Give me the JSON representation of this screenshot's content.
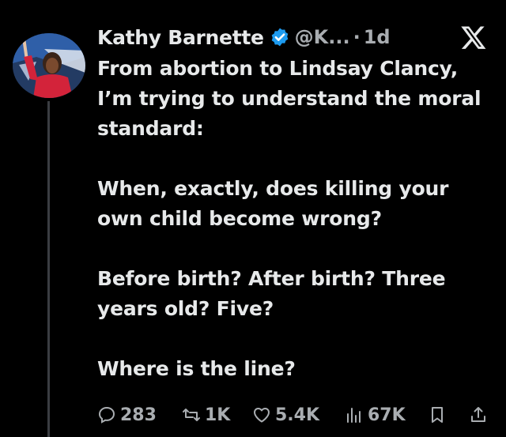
{
  "tweet": {
    "author_name": "Kathy Barnette",
    "handle": "@K...",
    "separator": "·",
    "time": "1d",
    "paragraphs": [
      "From abortion to Lindsay Clancy, I’m trying to understand the moral standard:",
      "When, exactly, does killing your own child become wrong?",
      "Before birth? After birth? Three years old? Five?",
      "Where is the line?"
    ]
  },
  "actions": {
    "replies": "283",
    "reposts": "1K",
    "likes": "5.4K",
    "views": "67K"
  },
  "icons": {
    "verified": "verified-badge-icon",
    "platform": "x-logo-icon",
    "reply": "reply-icon",
    "repost": "repost-icon",
    "like": "heart-icon",
    "views": "views-icon",
    "bookmark": "bookmark-icon",
    "share": "share-icon"
  },
  "colors": {
    "background": "#000000",
    "text": "#e7e9ea",
    "secondary": "#a9adb1",
    "verified": "#1d9bf0"
  }
}
